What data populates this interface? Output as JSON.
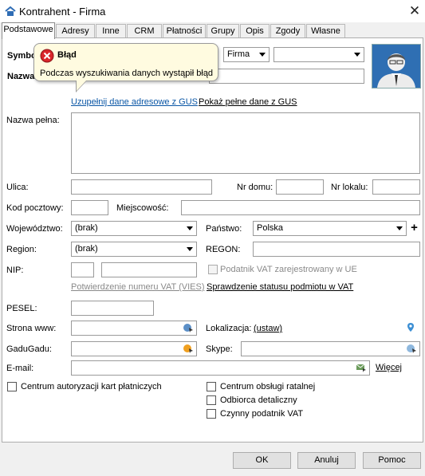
{
  "window": {
    "title": "Kontrahent - Firma",
    "close_glyph": "✕"
  },
  "tabs": [
    {
      "label": "Podstawowe",
      "active": true
    },
    {
      "label": "Adresy"
    },
    {
      "label": "Inne"
    },
    {
      "label": "CRM"
    },
    {
      "label": "Płatności"
    },
    {
      "label": "Grupy"
    },
    {
      "label": "Opis"
    },
    {
      "label": "Zgody"
    },
    {
      "label": "Własne"
    }
  ],
  "header": {
    "symbol_label": "Symbol",
    "nazwa_label": "Nazwa",
    "type_select": "Firma",
    "second_select": "",
    "avatar": "person-avatar-icon"
  },
  "tooltip": {
    "title": "Błąd",
    "message": "Podczas wyszukiwania danych wystąpił błąd",
    "icon": "error-icon"
  },
  "gus": {
    "fill_link": "Uzupełnij dane adresowe z GUS",
    "show_link": "Pokaż pełne dane z GUS"
  },
  "form": {
    "nazwa_pelna_label": "Nazwa pełna:",
    "nazwa_pelna_value": "",
    "ulica_label": "Ulica:",
    "ulica_value": "",
    "nr_domu_label": "Nr domu:",
    "nr_domu_value": "",
    "nr_lokalu_label": "Nr lokalu:",
    "nr_lokalu_value": "",
    "kod_label": "Kod pocztowy:",
    "kod_value": "",
    "miejscowosc_label": "Miejscowość:",
    "miejscowosc_value": "",
    "wojewodztwo_label": "Województwo:",
    "wojewodztwo_value": "(brak)",
    "panstwo_label": "Państwo:",
    "panstwo_value": "Polska",
    "add_glyph": "+",
    "region_label": "Region:",
    "region_value": "(brak)",
    "regon_label": "REGON:",
    "regon_value": "",
    "nip_label": "NIP:",
    "nip_prefix_value": "",
    "nip_value": "",
    "vat_ue_label": "Podatnik VAT zarejestrowany w UE",
    "vies_link": "Potwierdzenie numeru VAT (VIES)",
    "vat_status_link": "Sprawdzenie statusu podmiotu w VAT",
    "pesel_label": "PESEL:",
    "pesel_value": "",
    "www_label": "Strona www:",
    "www_value": "",
    "lokalizacja_label": "Lokalizacja:",
    "lokalizacja_link": "(ustaw)",
    "gadugadu_label": "GaduGadu:",
    "gadugadu_value": "",
    "skype_label": "Skype:",
    "skype_value": "",
    "email_label": "E-mail:",
    "email_value": "",
    "wiecej_link": "Więcej"
  },
  "checkboxes": {
    "centrum_autoryzacji": "Centrum autoryzacji kart płatniczych",
    "centrum_obslugi": "Centrum obsługi ratalnej",
    "odbiorca": "Odbiorca detaliczny",
    "czynny_vat": "Czynny podatnik VAT"
  },
  "buttons": {
    "ok": "OK",
    "anuluj": "Anuluj",
    "pomoc": "Pomoc"
  },
  "colors": {
    "link": "#0b57a6",
    "error": "#d9262b",
    "tooltip_bg": "#fffbe0"
  }
}
